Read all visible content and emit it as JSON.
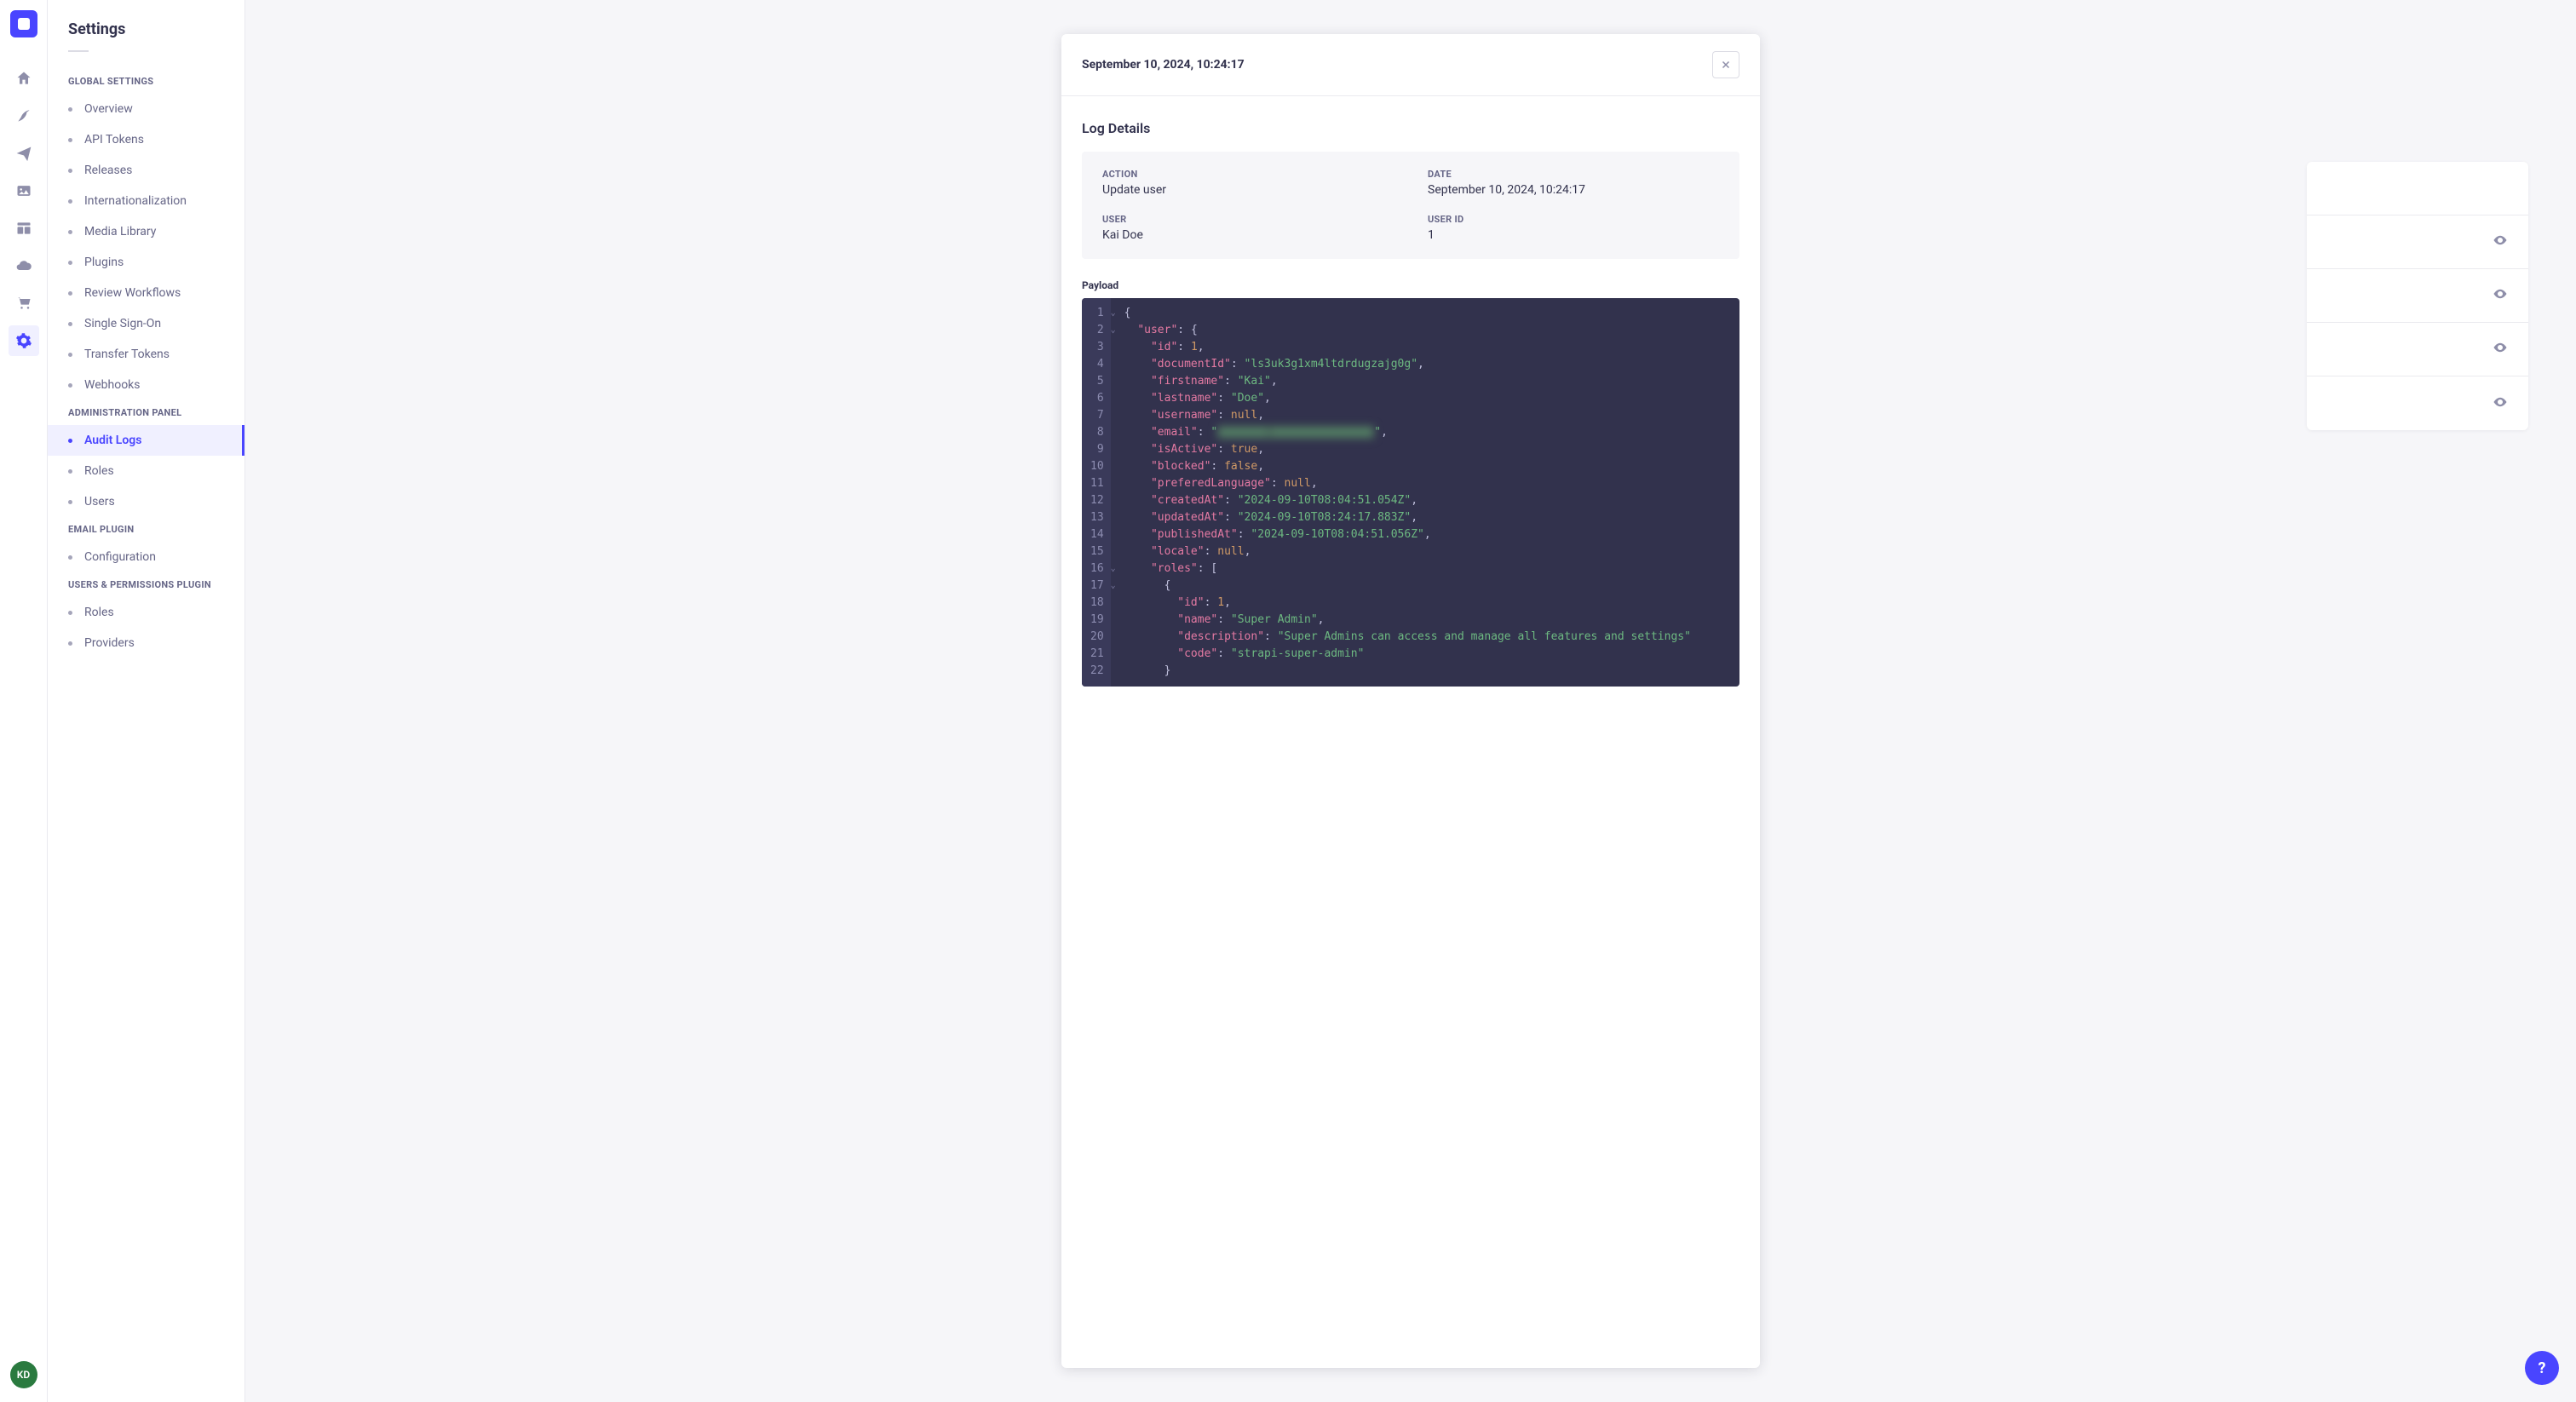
{
  "rail": {
    "avatar_initials": "KD"
  },
  "sidebar": {
    "title": "Settings",
    "sections": [
      {
        "label": "Global Settings",
        "items": [
          {
            "label": "Overview"
          },
          {
            "label": "API Tokens"
          },
          {
            "label": "Releases"
          },
          {
            "label": "Internationalization"
          },
          {
            "label": "Media Library"
          },
          {
            "label": "Plugins"
          },
          {
            "label": "Review Workflows"
          },
          {
            "label": "Single Sign-On"
          },
          {
            "label": "Transfer Tokens"
          },
          {
            "label": "Webhooks"
          }
        ]
      },
      {
        "label": "Administration Panel",
        "items": [
          {
            "label": "Audit Logs",
            "active": true
          },
          {
            "label": "Roles"
          },
          {
            "label": "Users"
          }
        ]
      },
      {
        "label": "Email Plugin",
        "items": [
          {
            "label": "Configuration"
          }
        ]
      },
      {
        "label": "Users & Permissions Plugin",
        "items": [
          {
            "label": "Roles"
          },
          {
            "label": "Providers"
          }
        ]
      }
    ]
  },
  "modal": {
    "title": "September 10, 2024, 10:24:17",
    "heading": "Log Details",
    "details": {
      "action_label": "Action",
      "action_value": "Update user",
      "date_label": "Date",
      "date_value": "September 10, 2024, 10:24:17",
      "user_label": "User",
      "user_value": "Kai Doe",
      "userid_label": "User ID",
      "userid_value": "1"
    },
    "payload_label": "Payload",
    "payload": {
      "user": {
        "id": 1,
        "documentId": "ls3uk3g1xm4ltdrdugzajg0g",
        "firstname": "Kai",
        "lastname": "Doe",
        "username": null,
        "email": "[redacted]",
        "isActive": true,
        "blocked": false,
        "preferedLanguage": null,
        "createdAt": "2024-09-10T08:04:51.054Z",
        "updatedAt": "2024-09-10T08:24:17.883Z",
        "publishedAt": "2024-09-10T08:04:51.056Z",
        "locale": null,
        "roles": [
          {
            "id": 1,
            "name": "Super Admin",
            "description": "Super Admins can access and manage all features and settings",
            "code": "strapi-super-admin"
          }
        ]
      }
    }
  },
  "help": {
    "symbol": "?"
  }
}
